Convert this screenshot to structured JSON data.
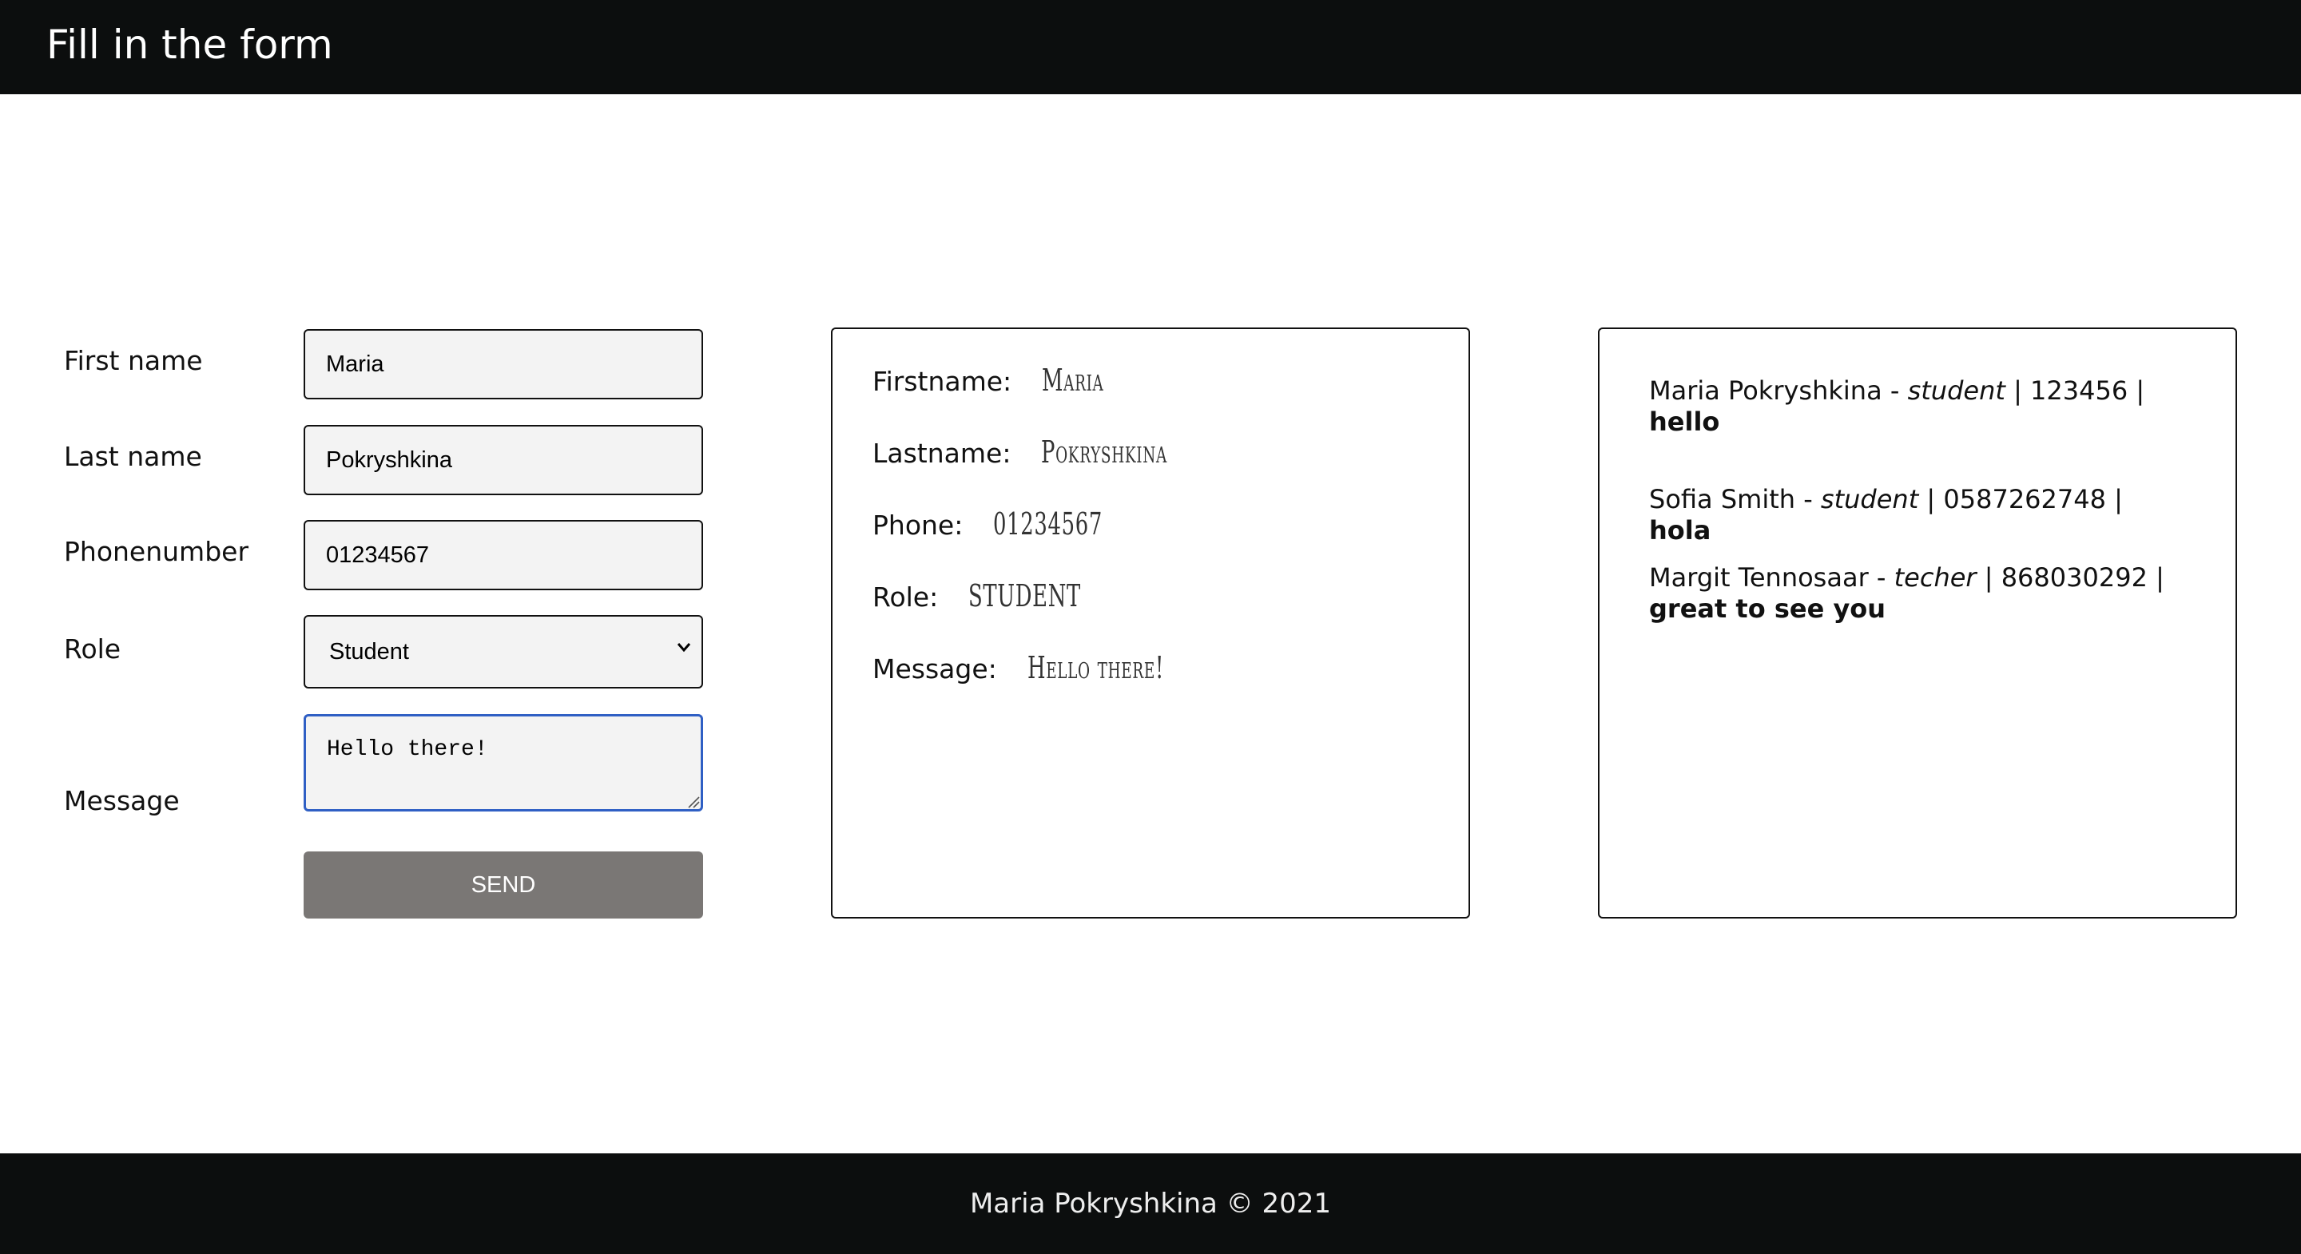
{
  "header": {
    "title": "Fill in the form"
  },
  "form": {
    "first_name": {
      "label": "First name",
      "value": "Maria"
    },
    "last_name": {
      "label": "Last name",
      "value": "Pokryshkina"
    },
    "phone": {
      "label": "Phonenumber",
      "value": "01234567"
    },
    "role": {
      "label": "Role",
      "selected": "Student"
    },
    "message": {
      "label": "Message",
      "value": "Hello there!"
    },
    "send_label": "SEND"
  },
  "preview": {
    "firstname": {
      "label": "Firstname:",
      "value": "Maria"
    },
    "lastname": {
      "label": "Lastname:",
      "value": "Pokryshkina"
    },
    "phone": {
      "label": "Phone:",
      "value": "01234567"
    },
    "role": {
      "label": "Role:",
      "value": "student"
    },
    "message": {
      "label": "Message:",
      "value": "Hello there!"
    }
  },
  "entries": [
    {
      "name": "Maria Pokryshkina",
      "role": "student",
      "phone": "123456",
      "message": "hello"
    },
    {
      "name": "Sofia Smith",
      "role": "student",
      "phone": "0587262748",
      "message": "hola"
    },
    {
      "name": "Margit Tennosaar",
      "role": "techer",
      "phone": "868030292",
      "message": "great to see you"
    }
  ],
  "footer": {
    "text": "Maria Pokryshkina © 2021"
  }
}
